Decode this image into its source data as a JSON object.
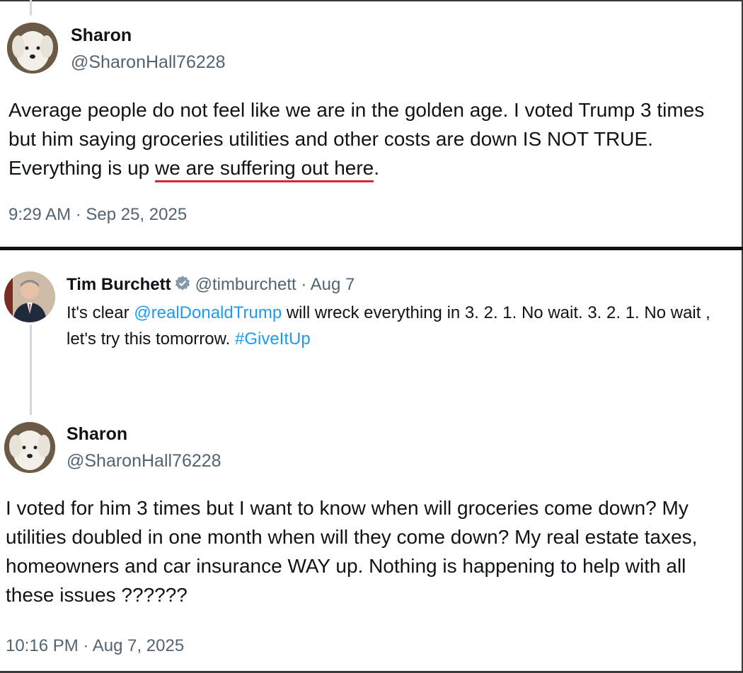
{
  "post1": {
    "name": "Sharon",
    "handle": "@SharonHall76228",
    "text_before": "Average people do not feel like we are in the golden age.  I voted Trump 3 times but him saying groceries utilities and other costs are down IS NOT TRUE.  Everything is up ",
    "text_underlined": "we are suffering out here",
    "text_after": ".",
    "timestamp": "9:29 AM · Sep 25, 2025",
    "underline_color": "#d9262d"
  },
  "quoted": {
    "name": "Tim Burchett",
    "handle": "@timburchett",
    "date": " · Aug 7",
    "text_1": "It's clear ",
    "mention": "@realDonaldTrump",
    "text_2": " will wreck everything in 3. 2. 1. No wait. 3. 2. 1. No wait , let's try this tomorrow. ",
    "hashtag": "#GiveItUp",
    "verified_icon": "verified-badge-icon"
  },
  "post2": {
    "name": "Sharon",
    "handle": "@SharonHall76228",
    "text": "I voted for him 3 times but I want to know when will groceries come down?  My utilities doubled in one month when will they come down?  My real estate taxes, homeowners and car insurance WAY up.  Nothing is happening to help with all these issues ??????",
    "timestamp": "10:16 PM · Aug 7, 2025"
  },
  "colors": {
    "link": "#1d9bf0",
    "secondary_text": "#536471",
    "primary_text": "#0f1419"
  }
}
